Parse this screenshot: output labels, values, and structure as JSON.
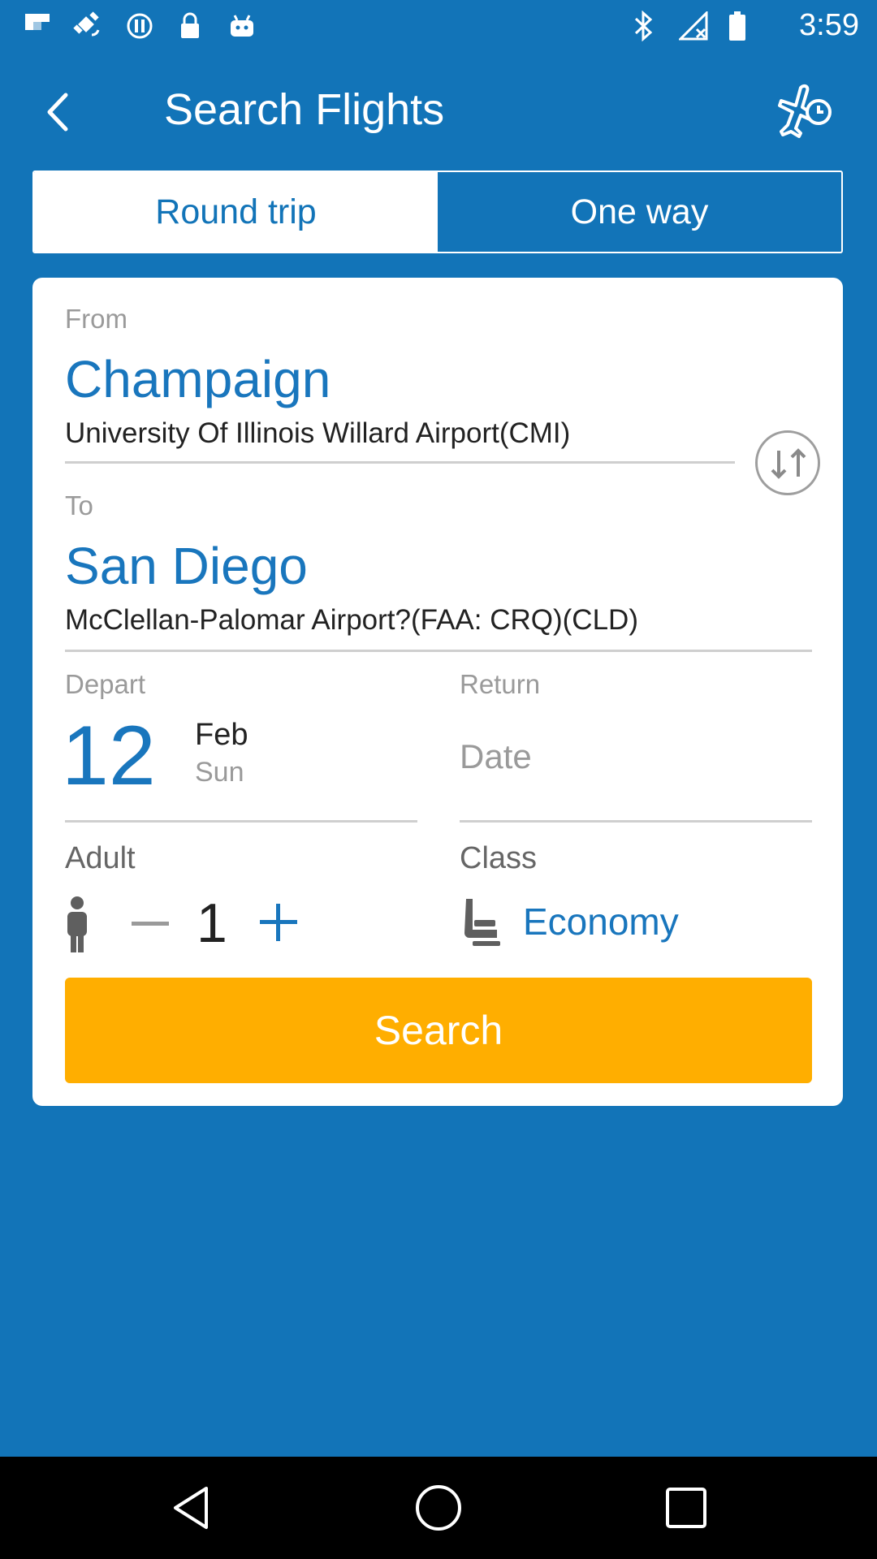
{
  "status_bar": {
    "time": "3:59",
    "icons": [
      "flipboard-icon",
      "fake-gps-icon",
      "sync-icon",
      "lock-icon",
      "android-icon",
      "bluetooth-icon",
      "no-signal-icon",
      "battery-icon"
    ]
  },
  "header": {
    "title": "Search Flights",
    "back_icon": "back-arrow-icon",
    "action_icon": "flight-status-icon"
  },
  "tabs": [
    {
      "label": "Round trip",
      "active": true
    },
    {
      "label": "One way",
      "active": false
    }
  ],
  "form": {
    "from": {
      "label": "From",
      "city": "Champaign",
      "airport": "University Of Illinois Willard Airport(CMI)"
    },
    "to": {
      "label": "To",
      "city": "San Diego",
      "airport": "McClellan-Palomar Airport?(FAA: CRQ)(CLD)"
    },
    "depart": {
      "label": "Depart",
      "day": "12",
      "month": "Feb",
      "weekday": "Sun"
    },
    "return": {
      "label": "Return",
      "placeholder": "Date"
    },
    "adult": {
      "label": "Adult",
      "count": "1"
    },
    "class": {
      "label": "Class",
      "value": "Economy"
    },
    "search_label": "Search"
  },
  "colors": {
    "background": "#1274b8",
    "accent": "#1976bd",
    "search_button": "#ffae00"
  }
}
